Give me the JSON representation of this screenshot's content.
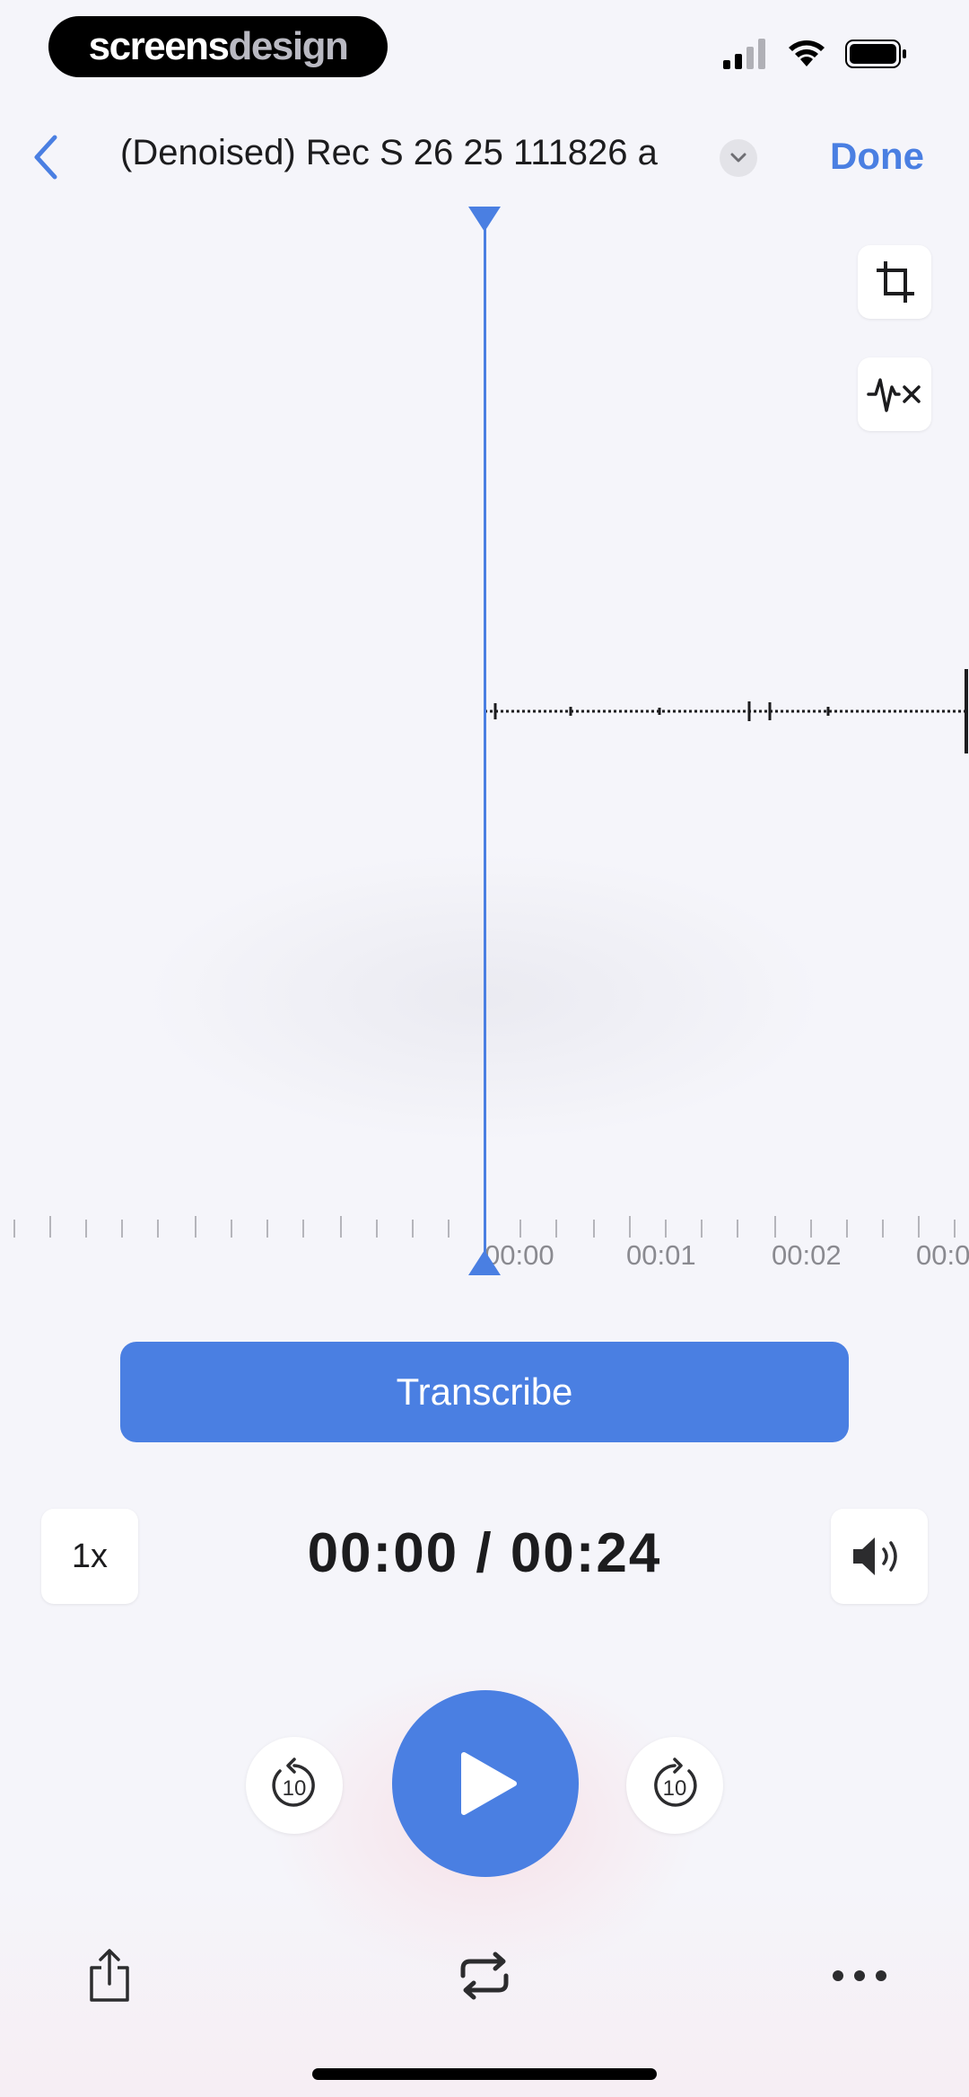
{
  "status_bar": {
    "brand_part1": "screens",
    "brand_part2": "design",
    "signal_icon": "cellular-signal-icon",
    "wifi_icon": "wifi-icon",
    "battery_icon": "battery-icon"
  },
  "nav": {
    "back_icon": "chevron-left-icon",
    "title": "(Denoised) Rec S 26 25 111826 a",
    "title_menu_icon": "chevron-down-icon",
    "done_label": "Done"
  },
  "tools": {
    "crop_icon": "crop-icon",
    "denoise_icon": "waveform-x-icon"
  },
  "timeline": {
    "labels": [
      "00:00",
      "00:01",
      "00:02",
      "00:0"
    ]
  },
  "actions": {
    "transcribe_label": "Transcribe"
  },
  "player": {
    "speed_label": "1x",
    "current_time": "00:00",
    "separator": "/",
    "total_time": "00:24",
    "time_display": "00:00 / 00:24",
    "volume_icon": "speaker-icon",
    "skip_back_label": "10",
    "skip_forward_label": "10",
    "play_icon": "play-icon"
  },
  "toolbar": {
    "share_icon": "share-icon",
    "loop_icon": "repeat-icon",
    "more_icon": "ellipsis-icon"
  },
  "colors": {
    "accent": "#4a7fe2",
    "background": "#f5f5fa",
    "text": "#1c1c1e"
  }
}
